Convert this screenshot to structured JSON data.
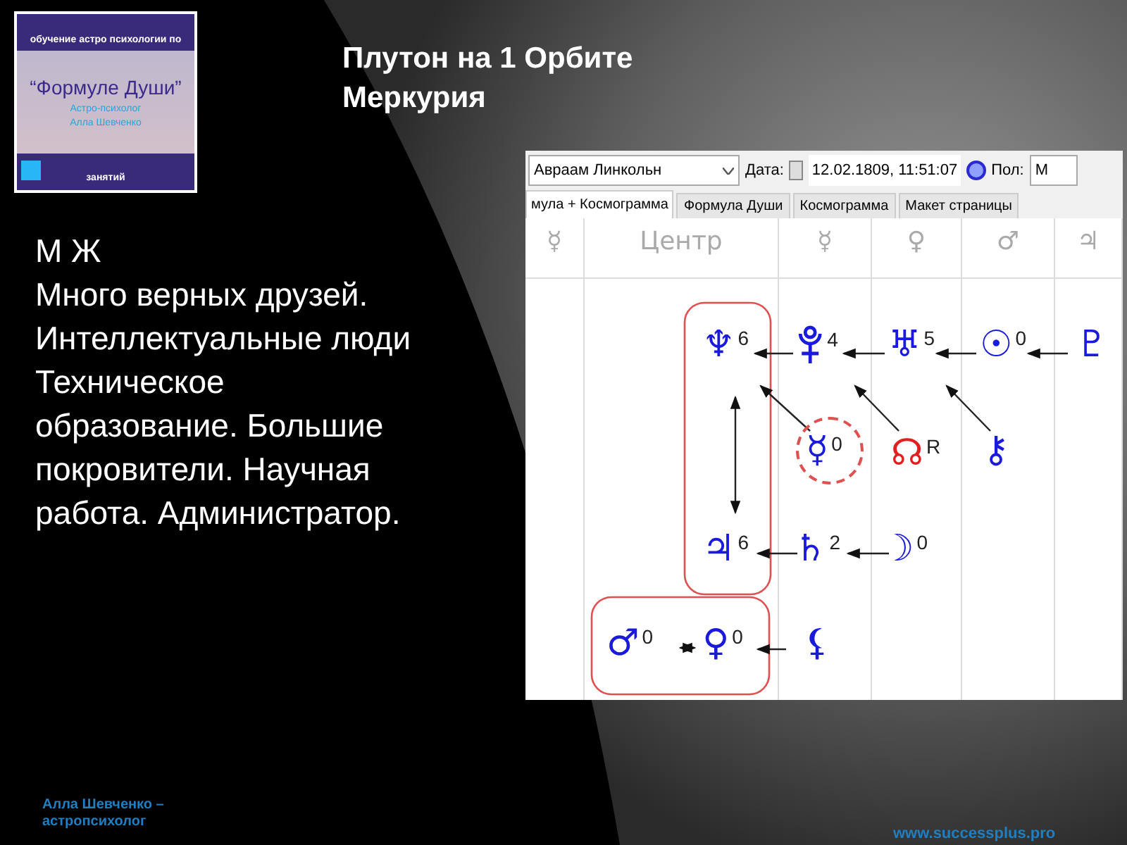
{
  "banner": {
    "subtitle": "обучение астро психологии по",
    "title": "“Формуле Души”",
    "author_role": "Астро-психолог",
    "author_name": "Алла Шевченко",
    "footer": "занятий"
  },
  "title_lines": [
    "Плутон на 1 Орбите",
    "Меркурия"
  ],
  "body_lines": [
    "М Ж",
    "Много верных друзей.",
    "Интеллектуальные люди",
    "Техническое",
    "образование. Большие",
    "покровители. Научная",
    "работа. Администратор."
  ],
  "app": {
    "person": "Авраам Линкольн",
    "date_label": "Дата:",
    "date_value": "12.02.1809, 11:51:07",
    "sex_label": "Пол:",
    "sex_value": "М",
    "tabs": [
      {
        "label": "мула + Космограмма",
        "selected": true
      },
      {
        "label": "Формула Души",
        "selected": false
      },
      {
        "label": "Космограмма",
        "selected": false
      },
      {
        "label": "Макет страницы",
        "selected": false
      }
    ],
    "columns": [
      "☿",
      "Центр",
      "☿",
      "♀",
      "♂",
      "♃"
    ],
    "nodes": [
      {
        "kind": "glyph",
        "symbol": "♆",
        "number": "6",
        "color": "#1a1adc",
        "highlighted": false
      },
      {
        "kind": "pluto",
        "number": "4",
        "color": "#1a1adc",
        "highlighted": false
      },
      {
        "kind": "glyph",
        "symbol": "♅",
        "number": "5",
        "color": "#1a1adc",
        "highlighted": false
      },
      {
        "kind": "glyph",
        "symbol": "☉",
        "number": "0",
        "color": "#1a1adc",
        "highlighted": false
      },
      {
        "kind": "glyph",
        "symbol": "♇",
        "color": "#1a1adc",
        "highlighted": false
      },
      {
        "kind": "glyph",
        "symbol": "☿",
        "number": "0",
        "color": "#1a1adc",
        "highlighted": true
      },
      {
        "kind": "glyph",
        "symbol": "☊",
        "number": "R",
        "color": "#e02020",
        "highlighted": false
      },
      {
        "kind": "glyph",
        "symbol": "⚷",
        "color": "#1a1adc",
        "highlighted": false
      },
      {
        "kind": "glyph",
        "symbol": "♃",
        "number": "6",
        "color": "#1a1adc",
        "highlighted": false
      },
      {
        "kind": "glyph",
        "symbol": "♄",
        "number": "2",
        "color": "#1a1adc",
        "highlighted": false
      },
      {
        "kind": "glyph",
        "symbol": "☽",
        "number": "0",
        "color": "#1a1adc",
        "highlighted": false
      },
      {
        "kind": "glyph",
        "symbol": "♂",
        "number": "0",
        "color": "#1a1adc",
        "highlighted": false
      },
      {
        "kind": "glyph",
        "symbol": "♀",
        "number": "0",
        "color": "#1a1adc",
        "highlighted": false
      },
      {
        "kind": "glyph",
        "symbol": "⚸",
        "color": "#1a1adc",
        "highlighted": false
      }
    ]
  },
  "footer": {
    "author": [
      "Алла Шевченко –",
      "астропсихолог"
    ],
    "website": "www.successplus.pro"
  }
}
